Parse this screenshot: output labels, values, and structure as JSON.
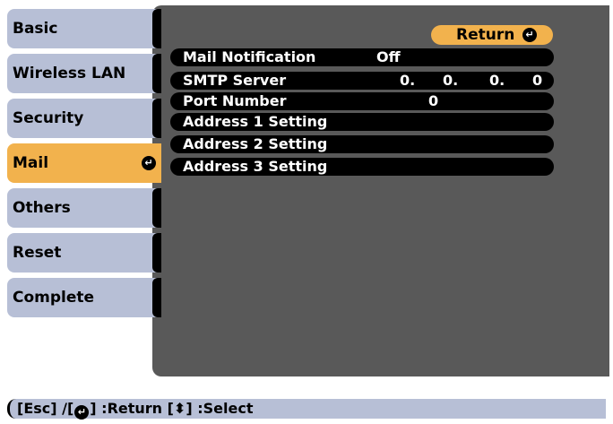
{
  "sidebar": {
    "items": [
      {
        "label": "Basic"
      },
      {
        "label": "Wireless LAN"
      },
      {
        "label": "Security"
      },
      {
        "label": "Mail"
      },
      {
        "label": "Others"
      },
      {
        "label": "Reset"
      },
      {
        "label": "Complete"
      }
    ],
    "active_index": 3
  },
  "panel": {
    "return_label": "Return",
    "rows": [
      {
        "label": "Mail Notification",
        "value": "Off"
      },
      {
        "label": "SMTP Server",
        "ip": [
          "0.",
          "0.",
          "0.",
          "0"
        ]
      },
      {
        "label": "Port Number",
        "value": "0"
      },
      {
        "label": "Address 1 Setting"
      },
      {
        "label": "Address 2 Setting"
      },
      {
        "label": "Address 3 Setting"
      }
    ]
  },
  "status_bar": {
    "esc": "[Esc] /[",
    "return_text": "] :Return  [",
    "arrows": "⬍",
    "select_text": "] :Select"
  },
  "colors": {
    "highlight": "#f2b24d",
    "tab": "#b7bfd6",
    "panel": "#595959"
  },
  "icons": {
    "enter": "enter-icon",
    "updown": "up-down-arrow-icon"
  }
}
